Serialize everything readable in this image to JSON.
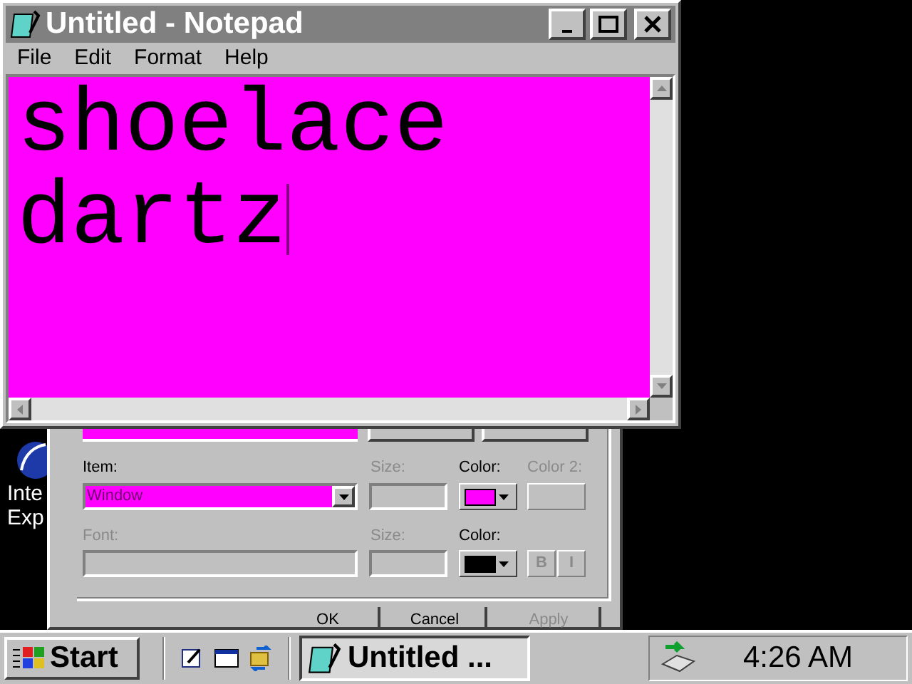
{
  "notepad": {
    "title": "Untitled - Notepad",
    "menu": [
      "File",
      "Edit",
      "Format",
      "Help"
    ],
    "text_lines": [
      "shoelace",
      "dartz"
    ]
  },
  "desktop_icon": {
    "label_lines": [
      "Inte",
      "Exp"
    ]
  },
  "display_dialog": {
    "item_label": "Item:",
    "item_value": "Window",
    "size_label": {
      "text": "Size:",
      "disabled": true
    },
    "color_label": {
      "text": "Color:",
      "disabled": false
    },
    "color2_label": {
      "text": "Color 2:",
      "disabled": true
    },
    "item_color": {
      "color": "#ff00ff"
    },
    "font_label": {
      "text": "Font:",
      "disabled": true
    },
    "font_size_label": {
      "text": "Size:",
      "disabled": true
    },
    "font_color_label": {
      "text": "Color:",
      "disabled": false
    },
    "font_color": {
      "color": "#000000"
    },
    "style_buttons": [
      {
        "label": "B",
        "disabled": true
      },
      {
        "label": "I",
        "disabled": true
      }
    ],
    "buttons": [
      {
        "label": "OK",
        "disabled": false
      },
      {
        "label": "Cancel",
        "disabled": false
      },
      {
        "label": "Apply",
        "disabled": true
      }
    ]
  },
  "taskbar": {
    "start": "Start",
    "task": "Untitled ...",
    "clock": "4:26 AM"
  }
}
